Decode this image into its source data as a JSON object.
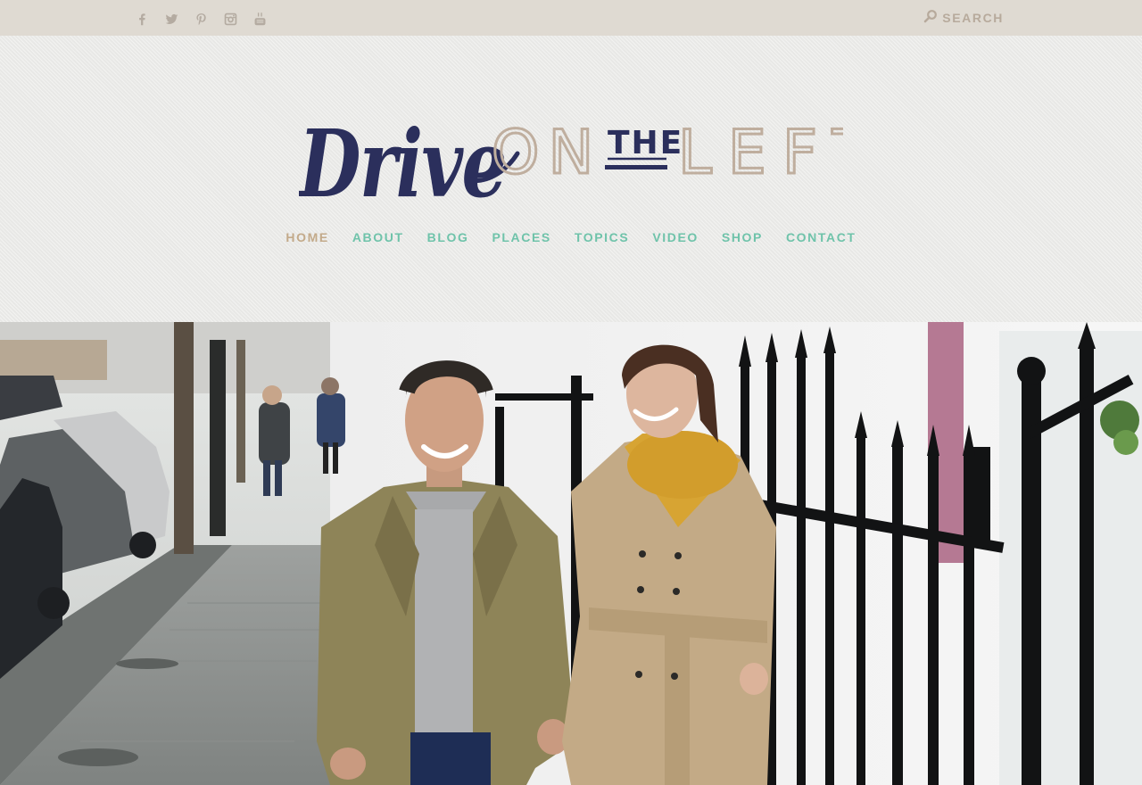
{
  "topbar": {
    "social_icons": [
      "facebook-icon",
      "twitter-icon",
      "pinterest-icon",
      "instagram-icon",
      "youtube-icon"
    ],
    "search_label": "SEARCH"
  },
  "logo": {
    "text_script": "Drive",
    "text_on": "ON",
    "text_the": "THE",
    "text_left": "LEFT"
  },
  "nav": {
    "items": [
      {
        "label": "HOME",
        "active": true
      },
      {
        "label": "ABOUT"
      },
      {
        "label": "BLOG"
      },
      {
        "label": "PLACES"
      },
      {
        "label": "TOPICS"
      },
      {
        "label": "VIDEO"
      },
      {
        "label": "SHOP"
      },
      {
        "label": "CONTACT"
      }
    ]
  },
  "colors": {
    "topbar_bg": "#dfdad2",
    "header_bg": "#ececea",
    "nav_text": "#6fc3aa",
    "nav_active": "#c3aa8a",
    "logo_navy": "#2b2f5c",
    "logo_tan": "#bfae9e"
  },
  "hero": {
    "description_icon": "photo-couple-walking-street"
  }
}
